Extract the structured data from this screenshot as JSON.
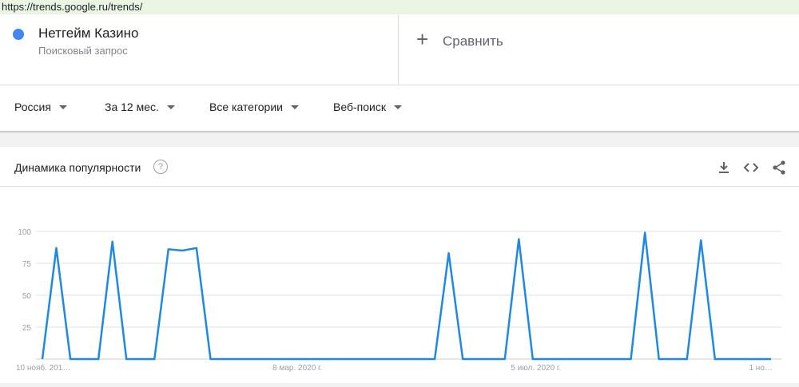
{
  "browser": {
    "url": "https://trends.google.ru/trends/"
  },
  "search_term": {
    "name": "Нетгейм Казино",
    "type": "Поисковый запрос",
    "color": "#4285f4"
  },
  "compare": {
    "label": "Сравнить",
    "icon": "plus-icon"
  },
  "filters": [
    {
      "label": "Россия"
    },
    {
      "label": "За 12 мес."
    },
    {
      "label": "Все категории"
    },
    {
      "label": "Веб-поиск"
    }
  ],
  "chart_panel": {
    "title": "Динамика популярности",
    "help_icon": "help-circle-icon",
    "tools": [
      "download-icon",
      "embed-code-icon",
      "share-icon"
    ]
  },
  "chart_data": {
    "type": "line",
    "title": "Динамика популярности",
    "ylim": [
      0,
      100
    ],
    "y_ticks": [
      25,
      50,
      75,
      100
    ],
    "grid": true,
    "x_tick_labels": [
      {
        "label": "10 нояб. 201…",
        "index": 0
      },
      {
        "label": "8 мар. 2020 г.",
        "index": 17
      },
      {
        "label": "5 июл. 2020 г.",
        "index": 34
      },
      {
        "label": "1 но…",
        "index": 51
      }
    ],
    "series": [
      {
        "color": "#1e88e5",
        "values": [
          0,
          87,
          0,
          0,
          0,
          92,
          0,
          0,
          0,
          86,
          85,
          87,
          0,
          0,
          0,
          0,
          0,
          0,
          0,
          0,
          0,
          0,
          0,
          0,
          0,
          0,
          0,
          0,
          0,
          83,
          0,
          0,
          0,
          0,
          94,
          0,
          0,
          0,
          0,
          0,
          0,
          0,
          0,
          99,
          0,
          0,
          0,
          93,
          0,
          0,
          0,
          0,
          0
        ]
      }
    ]
  }
}
